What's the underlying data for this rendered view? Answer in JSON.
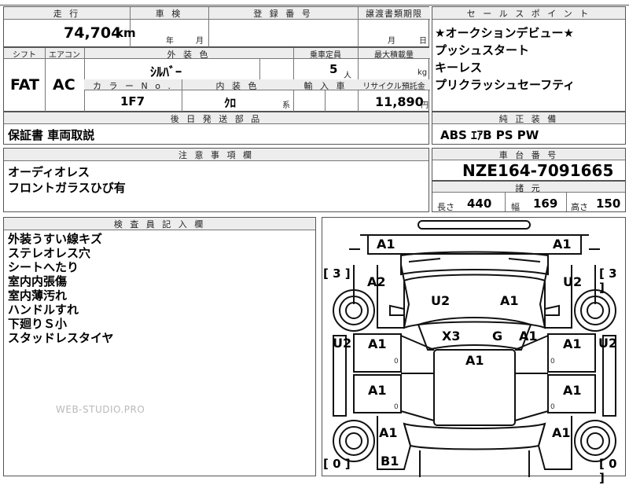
{
  "top_info": {
    "mileage_header": "走 行",
    "mileage_value": "74,704",
    "mileage_unit": "km",
    "inspection_header": "車 検",
    "inspection_year": "年",
    "inspection_month": "月",
    "registration_header": "登 録 番 号",
    "transfer_header": "譲渡書類期限",
    "transfer_month": "月",
    "transfer_day": "日"
  },
  "specs": {
    "shift_header": "シフト",
    "shift_value": "FAT",
    "ac_header": "エアコン",
    "ac_value": "AC",
    "exterior_color_header": "外 装 色",
    "exterior_color_value": "ｼﾙﾊﾞｰ",
    "capacity_header": "乗車定員",
    "capacity_value": "5",
    "capacity_unit": "人",
    "max_load_header": "最大積載量",
    "max_load_unit": "kg",
    "color_no_header": "カ ラ ー N o .",
    "color_no_value": "1F7",
    "interior_color_header": "内 装 色",
    "interior_color_value": "ｸﾛ",
    "interior_color_suffix": "系",
    "import_header": "輸 入 車",
    "recycle_header": "リサイクル預託金",
    "recycle_value": "11,890",
    "recycle_unit": "円"
  },
  "sales_points": {
    "header": "セ ー ル ス ポ イ ン ト",
    "items": [
      "★オークションデビュー★",
      "プッシュスタート",
      "キーレス",
      "プリクラッシュセーフティ"
    ]
  },
  "later_parts": {
    "header": "後 日 発 送 部 品",
    "value": "保証書 車両取説"
  },
  "genuine_equipment": {
    "header": "純 正 装 備",
    "value": "ABS ｴｱB PS PW"
  },
  "notes": {
    "header": "注 意 事 項 欄",
    "lines": [
      "オーディオレス",
      "フロントガラスひび有"
    ]
  },
  "chassis": {
    "header": "車 台 番 号",
    "value": "NZE164-7091665"
  },
  "dimensions": {
    "header": "諸 元",
    "length_label": "長さ",
    "length_value": "440",
    "width_label": "幅",
    "width_value": "169",
    "height_label": "高さ",
    "height_value": "150"
  },
  "inspector": {
    "header": "検 査 員 記 入 欄",
    "lines": [
      "外装うすい線キズ",
      "ステレオレス穴",
      "シートへたり",
      "室内内張傷",
      "室内薄汚れ",
      "ハンドルすれ",
      "下廻りＳ小",
      "スタッドレスタイヤ"
    ]
  },
  "watermark": "WEB-STUDIO.PRO",
  "diagram": {
    "marks": {
      "front_left": "A1",
      "front_right": "A1",
      "fender_left": "A2",
      "fender_right": "U2",
      "hood_left": "U2",
      "hood_right": "A1",
      "windshield_x": "X3",
      "windshield_g": "G",
      "windshield_a": "A1",
      "roof": "A1",
      "front_door_left": "A1",
      "front_door_right": "A1",
      "rear_door_left": "A1",
      "rear_door_right": "A1",
      "rear_fender_left": "A1",
      "rear_fender_right": "A1",
      "bumper_rear": "B1",
      "side_left": "U2",
      "side_right": "U2"
    },
    "tire_left_top": "3",
    "tire_right_top": "3",
    "tire_left_bottom": "0",
    "tire_right_bottom": "0",
    "zero": "0"
  }
}
